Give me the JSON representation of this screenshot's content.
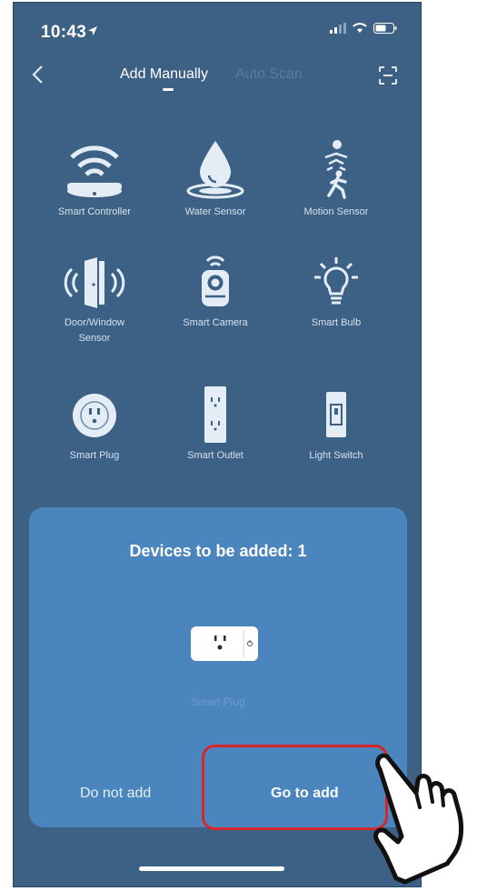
{
  "status_bar": {
    "time": "10:43"
  },
  "nav": {
    "tabs": [
      {
        "label": "Add Manually",
        "active": true
      },
      {
        "label": "Auto Scan",
        "active": false
      }
    ]
  },
  "devices": [
    {
      "label": "Smart Controller",
      "icon": "router-wifi-icon"
    },
    {
      "label": "Water Sensor",
      "icon": "water-drop-icon"
    },
    {
      "label": "Motion Sensor",
      "icon": "motion-person-icon"
    },
    {
      "label": "Door/Window Sensor",
      "line1": "Door/Window",
      "line2": "Sensor",
      "icon": "door-sensor-icon"
    },
    {
      "label": "Smart Camera",
      "icon": "camera-icon"
    },
    {
      "label": "Smart Bulb",
      "icon": "bulb-icon"
    },
    {
      "label": "Smart Plug",
      "icon": "plug-icon"
    },
    {
      "label": "Smart Outlet",
      "icon": "outlet-icon"
    },
    {
      "label": "Light Switch",
      "icon": "switch-icon"
    }
  ],
  "sheet": {
    "title": "Devices to be added: 1",
    "found_device": "Smart Plug",
    "cancel_label": "Do not add",
    "confirm_label": "Go to add"
  },
  "colors": {
    "background": "#3d6185",
    "sheet": "#4a86bd",
    "highlight": "#d5262b"
  }
}
